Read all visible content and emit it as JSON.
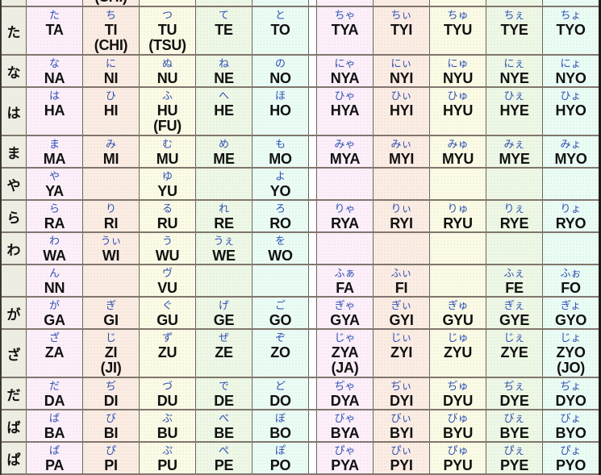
{
  "colors": {
    "col_a": "#fdf0fb",
    "col_i": "#fcede4",
    "col_u": "#fbfbe6",
    "col_e": "#eef8e6",
    "col_o": "#eafdf5",
    "header_bg": "#edede2",
    "gap": "#ffffff",
    "kana_text": "#2c4fb4",
    "romaji_text": "#111111",
    "grid_line_h": "#80766d",
    "grid_line_v": "#6a645e"
  },
  "table": {
    "rows": [
      {
        "header": "",
        "basic": [
          {},
          {
            "alt": "(SHI)"
          },
          {},
          {},
          {}
        ],
        "yoon": [
          {},
          {},
          {},
          {},
          {}
        ]
      },
      {
        "header": "た",
        "basic": [
          {
            "kana": "た",
            "romaji": "TA"
          },
          {
            "kana": "ち",
            "romaji": "TI",
            "alt": "(CHI)"
          },
          {
            "kana": "つ",
            "romaji": "TU",
            "alt": "(TSU)"
          },
          {
            "kana": "て",
            "romaji": "TE"
          },
          {
            "kana": "と",
            "romaji": "TO"
          }
        ],
        "yoon": [
          {
            "kana": "ちゃ",
            "romaji": "TYA"
          },
          {
            "kana": "ちぃ",
            "romaji": "TYI"
          },
          {
            "kana": "ちゅ",
            "romaji": "TYU"
          },
          {
            "kana": "ちぇ",
            "romaji": "TYE"
          },
          {
            "kana": "ちょ",
            "romaji": "TYO"
          }
        ]
      },
      {
        "header": "な",
        "basic": [
          {
            "kana": "な",
            "romaji": "NA"
          },
          {
            "kana": "に",
            "romaji": "NI"
          },
          {
            "kana": "ぬ",
            "romaji": "NU"
          },
          {
            "kana": "ね",
            "romaji": "NE"
          },
          {
            "kana": "の",
            "romaji": "NO"
          }
        ],
        "yoon": [
          {
            "kana": "にゃ",
            "romaji": "NYA"
          },
          {
            "kana": "にぃ",
            "romaji": "NYI"
          },
          {
            "kana": "にゅ",
            "romaji": "NYU"
          },
          {
            "kana": "にぇ",
            "romaji": "NYE"
          },
          {
            "kana": "にょ",
            "romaji": "NYO"
          }
        ]
      },
      {
        "header": "は",
        "basic": [
          {
            "kana": "は",
            "romaji": "HA"
          },
          {
            "kana": "ひ",
            "romaji": "HI"
          },
          {
            "kana": "ふ",
            "romaji": "HU",
            "alt": "(FU)"
          },
          {
            "kana": "へ",
            "romaji": "HE"
          },
          {
            "kana": "ほ",
            "romaji": "HO"
          }
        ],
        "yoon": [
          {
            "kana": "ひゃ",
            "romaji": "HYA"
          },
          {
            "kana": "ひぃ",
            "romaji": "HYI"
          },
          {
            "kana": "ひゅ",
            "romaji": "HYU"
          },
          {
            "kana": "ひぇ",
            "romaji": "HYE"
          },
          {
            "kana": "ひょ",
            "romaji": "HYO"
          }
        ]
      },
      {
        "header": "ま",
        "basic": [
          {
            "kana": "ま",
            "romaji": "MA"
          },
          {
            "kana": "み",
            "romaji": "MI"
          },
          {
            "kana": "む",
            "romaji": "MU"
          },
          {
            "kana": "め",
            "romaji": "ME"
          },
          {
            "kana": "も",
            "romaji": "MO"
          }
        ],
        "yoon": [
          {
            "kana": "みゃ",
            "romaji": "MYA"
          },
          {
            "kana": "みぃ",
            "romaji": "MYI"
          },
          {
            "kana": "みゅ",
            "romaji": "MYU"
          },
          {
            "kana": "みぇ",
            "romaji": "MYE"
          },
          {
            "kana": "みょ",
            "romaji": "MYO"
          }
        ]
      },
      {
        "header": "や",
        "basic": [
          {
            "kana": "や",
            "romaji": "YA"
          },
          {},
          {
            "kana": "ゆ",
            "romaji": "YU"
          },
          {},
          {
            "kana": "よ",
            "romaji": "YO"
          }
        ],
        "yoon": [
          {},
          {},
          {},
          {},
          {}
        ]
      },
      {
        "header": "ら",
        "basic": [
          {
            "kana": "ら",
            "romaji": "RA"
          },
          {
            "kana": "り",
            "romaji": "RI"
          },
          {
            "kana": "る",
            "romaji": "RU"
          },
          {
            "kana": "れ",
            "romaji": "RE"
          },
          {
            "kana": "ろ",
            "romaji": "RO"
          }
        ],
        "yoon": [
          {
            "kana": "りゃ",
            "romaji": "RYA"
          },
          {
            "kana": "りぃ",
            "romaji": "RYI"
          },
          {
            "kana": "りゅ",
            "romaji": "RYU"
          },
          {
            "kana": "りぇ",
            "romaji": "RYE"
          },
          {
            "kana": "りょ",
            "romaji": "RYO"
          }
        ]
      },
      {
        "header": "わ",
        "basic": [
          {
            "kana": "わ",
            "romaji": "WA"
          },
          {
            "kana": "うぃ",
            "romaji": "WI"
          },
          {
            "kana": "う",
            "romaji": "WU"
          },
          {
            "kana": "うぇ",
            "romaji": "WE"
          },
          {
            "kana": "を",
            "romaji": "WO"
          }
        ],
        "yoon": [
          {},
          {},
          {},
          {},
          {}
        ]
      },
      {
        "header": "",
        "basic": [
          {
            "kana": "ん",
            "romaji": "NN"
          },
          {},
          {
            "kana": "ヴ",
            "romaji": "VU"
          },
          {},
          {}
        ],
        "yoon": [
          {
            "kana": "ふぁ",
            "romaji": "FA"
          },
          {
            "kana": "ふぃ",
            "romaji": "FI"
          },
          {},
          {
            "kana": "ふぇ",
            "romaji": "FE"
          },
          {
            "kana": "ふぉ",
            "romaji": "FO"
          }
        ]
      },
      {
        "header": "が",
        "basic": [
          {
            "kana": "が",
            "romaji": "GA"
          },
          {
            "kana": "ぎ",
            "romaji": "GI"
          },
          {
            "kana": "ぐ",
            "romaji": "GU"
          },
          {
            "kana": "げ",
            "romaji": "GE"
          },
          {
            "kana": "ご",
            "romaji": "GO"
          }
        ],
        "yoon": [
          {
            "kana": "ぎゃ",
            "romaji": "GYA"
          },
          {
            "kana": "ぎぃ",
            "romaji": "GYI"
          },
          {
            "kana": "ぎゅ",
            "romaji": "GYU"
          },
          {
            "kana": "ぎぇ",
            "romaji": "GYE"
          },
          {
            "kana": "ぎょ",
            "romaji": "GYO"
          }
        ]
      },
      {
        "header": "ざ",
        "basic": [
          {
            "kana": "ざ",
            "romaji": "ZA"
          },
          {
            "kana": "じ",
            "romaji": "ZI",
            "alt": "(JI)"
          },
          {
            "kana": "ず",
            "romaji": "ZU"
          },
          {
            "kana": "ぜ",
            "romaji": "ZE"
          },
          {
            "kana": "ぞ",
            "romaji": "ZO"
          }
        ],
        "yoon": [
          {
            "kana": "じゃ",
            "romaji": "ZYA",
            "alt": "(JA)"
          },
          {
            "kana": "じぃ",
            "romaji": "ZYI"
          },
          {
            "kana": "じゅ",
            "romaji": "ZYU"
          },
          {
            "kana": "じぇ",
            "romaji": "ZYE"
          },
          {
            "kana": "じょ",
            "romaji": "ZYO",
            "alt": "(JO)"
          }
        ]
      },
      {
        "header": "だ",
        "basic": [
          {
            "kana": "だ",
            "romaji": "DA"
          },
          {
            "kana": "ぢ",
            "romaji": "DI"
          },
          {
            "kana": "づ",
            "romaji": "DU"
          },
          {
            "kana": "で",
            "romaji": "DE"
          },
          {
            "kana": "ど",
            "romaji": "DO"
          }
        ],
        "yoon": [
          {
            "kana": "ぢゃ",
            "romaji": "DYA"
          },
          {
            "kana": "ぢぃ",
            "romaji": "DYI"
          },
          {
            "kana": "ぢゅ",
            "romaji": "DYU"
          },
          {
            "kana": "ぢぇ",
            "romaji": "DYE"
          },
          {
            "kana": "ぢょ",
            "romaji": "DYO"
          }
        ]
      },
      {
        "header": "ば",
        "basic": [
          {
            "kana": "ば",
            "romaji": "BA"
          },
          {
            "kana": "び",
            "romaji": "BI"
          },
          {
            "kana": "ぶ",
            "romaji": "BU"
          },
          {
            "kana": "べ",
            "romaji": "BE"
          },
          {
            "kana": "ぼ",
            "romaji": "BO"
          }
        ],
        "yoon": [
          {
            "kana": "びゃ",
            "romaji": "BYA"
          },
          {
            "kana": "びぃ",
            "romaji": "BYI"
          },
          {
            "kana": "びゅ",
            "romaji": "BYU"
          },
          {
            "kana": "びぇ",
            "romaji": "BYE"
          },
          {
            "kana": "びょ",
            "romaji": "BYO"
          }
        ]
      },
      {
        "header": "ぱ",
        "basic": [
          {
            "kana": "ぱ",
            "romaji": "PA"
          },
          {
            "kana": "ぴ",
            "romaji": "PI"
          },
          {
            "kana": "ぷ",
            "romaji": "PU"
          },
          {
            "kana": "ぺ",
            "romaji": "PE"
          },
          {
            "kana": "ぽ",
            "romaji": "PO"
          }
        ],
        "yoon": [
          {
            "kana": "ぴゃ",
            "romaji": "PYA"
          },
          {
            "kana": "ぴぃ",
            "romaji": "PYI"
          },
          {
            "kana": "ぴゅ",
            "romaji": "PYU"
          },
          {
            "kana": "ぴぇ",
            "romaji": "PYE"
          },
          {
            "kana": "ぴょ",
            "romaji": "PYO"
          }
        ]
      }
    ]
  }
}
